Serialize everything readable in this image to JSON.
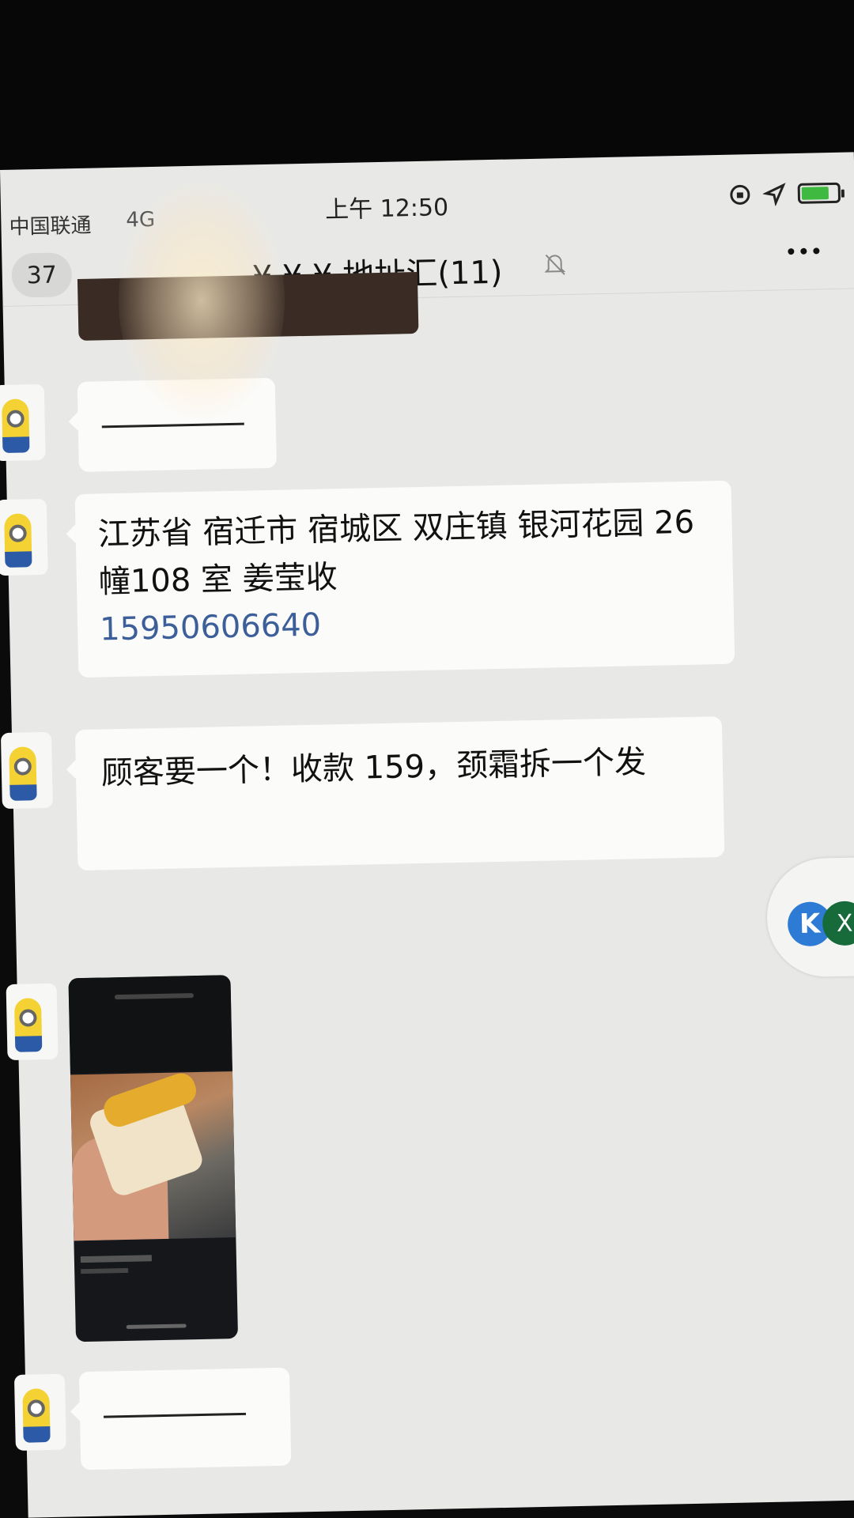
{
  "status_bar": {
    "carrier": "中国联通",
    "network": "4G",
    "time": "上午 12:50",
    "icons": [
      "orientation-lock-icon",
      "location-arrow-icon",
      "battery-charging-icon"
    ],
    "battery_color": "#40b940"
  },
  "nav": {
    "back_count": "37",
    "title": "¥ ¥ ¥ 地址汇(11)",
    "mute_icon": "bell-off-icon",
    "more_icon": "more-dots-icon"
  },
  "messages": [
    {
      "type": "text",
      "text": "————"
    },
    {
      "type": "text",
      "text": "江苏省 宿迁市 宿城区 双庄镇 银河花园 26幢108 室 姜莹收",
      "phone": "15950606640"
    },
    {
      "type": "text",
      "text": "顾客要一个！收款 159，颈霜拆一个发"
    },
    {
      "type": "image",
      "description": "screenshot"
    },
    {
      "type": "text",
      "text": "————"
    }
  ],
  "floating": {
    "left_letter": "K",
    "right_letter": "X",
    "left_color": "#2e7bd6",
    "right_color": "#176b3b"
  },
  "colors": {
    "chat_background": "#e8e9e7",
    "bubble": "#fbfbfa",
    "link": "#3c5f9a"
  }
}
